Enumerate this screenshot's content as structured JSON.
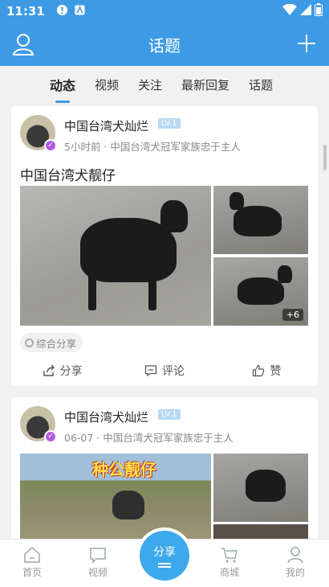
{
  "status_bar": {
    "time": "11:31"
  },
  "app_bar": {
    "title": "话题",
    "left_icon": "user-icon",
    "right_icon": "plus-icon"
  },
  "tabs": [
    {
      "label": "动态",
      "active": true
    },
    {
      "label": "视频",
      "active": false
    },
    {
      "label": "关注",
      "active": false
    },
    {
      "label": "最新回复",
      "active": false
    },
    {
      "label": "话题",
      "active": false
    }
  ],
  "posts": [
    {
      "username": "中国台湾犬灿烂",
      "level": "LV.1",
      "time": "5小时前",
      "meta_sep": " · ",
      "group": "中国台湾犬冠军家族忠于主人",
      "title": "中国台湾犬靓仔",
      "more_images": "+6",
      "tag": "综合分享",
      "actions": {
        "share": "分享",
        "comment": "评论",
        "like": "赞"
      }
    },
    {
      "username": "中国台湾犬灿烂",
      "level": "LV.1",
      "time": "06-07",
      "meta_sep": " · ",
      "group": "中国台湾犬冠军家族忠于主人",
      "banner_text": "种公靓仔"
    }
  ],
  "bottom_nav": {
    "home": "首页",
    "video": "视频",
    "share": "分享",
    "mall": "商城",
    "mine": "我的"
  },
  "colors": {
    "primary": "#3d9ae4",
    "fab": "#3da9ec",
    "level_badge": "#b9d9f3",
    "verified": "#b05be0"
  }
}
